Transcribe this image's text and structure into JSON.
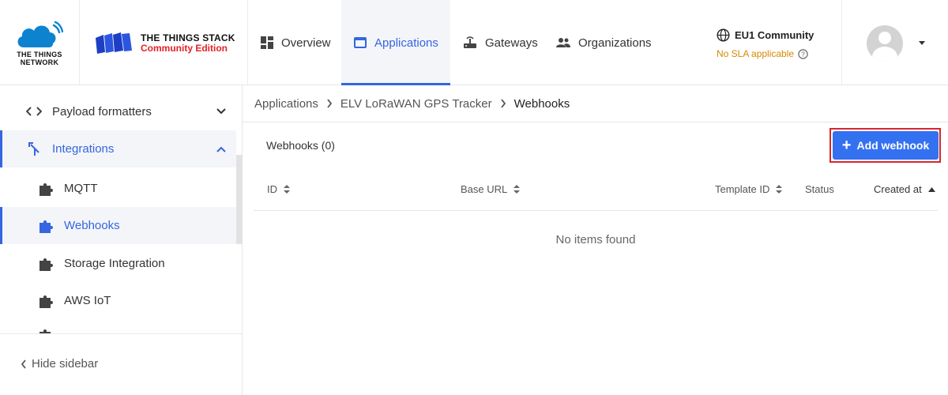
{
  "header": {
    "ttn_logo_text": "THE THINGS NETWORK",
    "tts_title": "THE THINGS STACK",
    "tts_subtitle": "Community Edition",
    "nav": [
      {
        "label": "Overview",
        "icon": "dashboard-icon",
        "active": false
      },
      {
        "label": "Applications",
        "icon": "application-window-icon",
        "active": true
      },
      {
        "label": "Gateways",
        "icon": "router-icon",
        "active": false
      },
      {
        "label": "Organizations",
        "icon": "people-icon",
        "active": false
      }
    ],
    "cluster": {
      "name": "EU1 Community",
      "sla": "No SLA applicable",
      "icon": "globe-icon",
      "help_icon": "help-circle-icon"
    },
    "profile": {
      "avatar_icon": "avatar-icon",
      "caret_icon": "caret-down-icon"
    }
  },
  "sidebar": {
    "items": [
      {
        "label": "Payload formatters",
        "icon": "code-icon",
        "chevron": "chevron-down-icon"
      },
      {
        "label": "Integrations",
        "icon": "merge-icon",
        "chevron": "chevron-up-icon",
        "active": true
      }
    ],
    "sub_items": [
      {
        "label": "MQTT",
        "icon": "puzzle-icon"
      },
      {
        "label": "Webhooks",
        "icon": "puzzle-icon",
        "active": true
      },
      {
        "label": "Storage Integration",
        "icon": "puzzle-icon"
      },
      {
        "label": "AWS IoT",
        "icon": "puzzle-icon"
      }
    ],
    "hide_label": "Hide sidebar"
  },
  "breadcrumb": [
    "Applications",
    "ELV LoRaWAN GPS Tracker",
    "Webhooks"
  ],
  "main": {
    "title": "Webhooks (0)",
    "add_button": "Add webhook",
    "columns": [
      "ID",
      "Base URL",
      "Template ID",
      "Status",
      "Created at"
    ],
    "empty_text": "No items found"
  },
  "colors": {
    "accent": "#3565e0",
    "button": "#3371f0",
    "highlight": "#d8262c",
    "sla": "#d68a00"
  }
}
